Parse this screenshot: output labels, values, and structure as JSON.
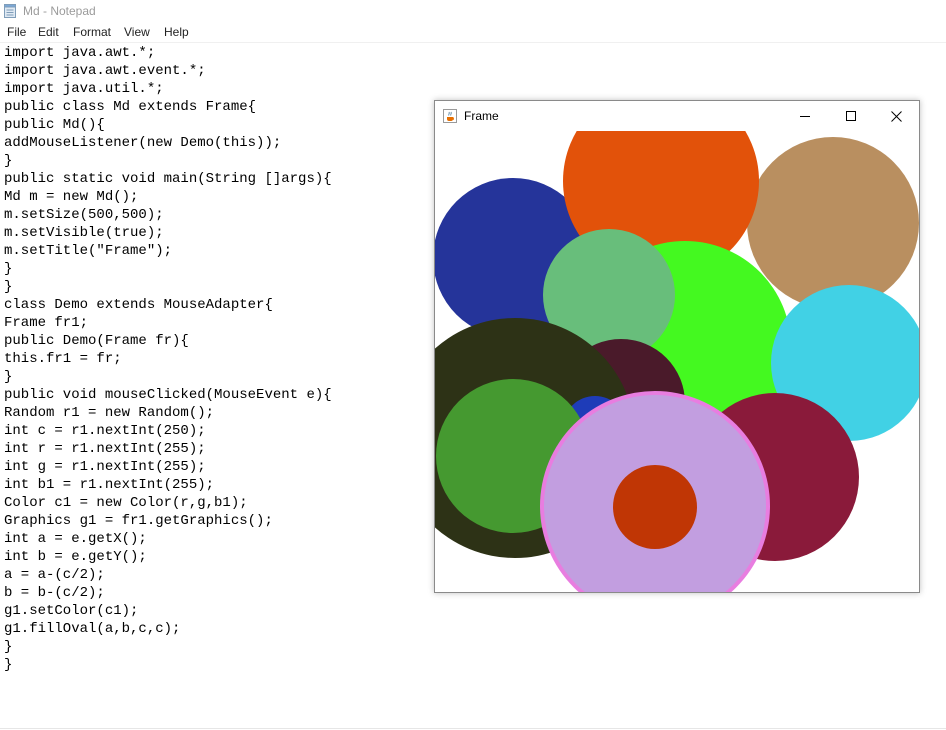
{
  "notepad": {
    "title": "Md - Notepad",
    "menu": [
      "File",
      "Edit",
      "Format",
      "View",
      "Help"
    ],
    "code_lines": [
      "import java.awt.*;",
      "import java.awt.event.*;",
      "import java.util.*;",
      "public class Md extends Frame{",
      "public Md(){",
      "addMouseListener(new Demo(this));",
      "}",
      "public static void main(String []args){",
      "Md m = new Md();",
      "m.setSize(500,500);",
      "m.setVisible(true);",
      "m.setTitle(\"Frame\");",
      "}",
      "}",
      "class Demo extends MouseAdapter{",
      "Frame fr1;",
      "public Demo(Frame fr){",
      "this.fr1 = fr;",
      "}",
      "public void mouseClicked(MouseEvent e){",
      "Random r1 = new Random();",
      "int c = r1.nextInt(250);",
      "int r = r1.nextInt(255);",
      "int g = r1.nextInt(255);",
      "int b1 = r1.nextInt(255);",
      "Color c1 = new Color(r,g,b1);",
      "Graphics g1 = fr1.getGraphics();",
      "int a = e.getX();",
      "int b = e.getY();",
      "a = a-(c/2);",
      "b = b-(c/2);",
      "g1.setColor(c1);",
      "g1.fillOval(a,b,c,c);",
      "}",
      "}"
    ]
  },
  "frame": {
    "title": "Frame",
    "icons": {
      "app": "java-cup-icon",
      "minimize": "minimize-icon",
      "maximize": "maximize-icon",
      "close": "close-icon"
    },
    "circle_colors": [
      "#25349a",
      "#b98f60",
      "#e2520a",
      "#44f920",
      "#68be7b",
      "#41d1e5",
      "#4a1a2a",
      "#2d3216",
      "#1e3cb8",
      "#8a1a3a",
      "#459930",
      "#e87de0",
      "#c29ee0",
      "#c03605"
    ]
  }
}
